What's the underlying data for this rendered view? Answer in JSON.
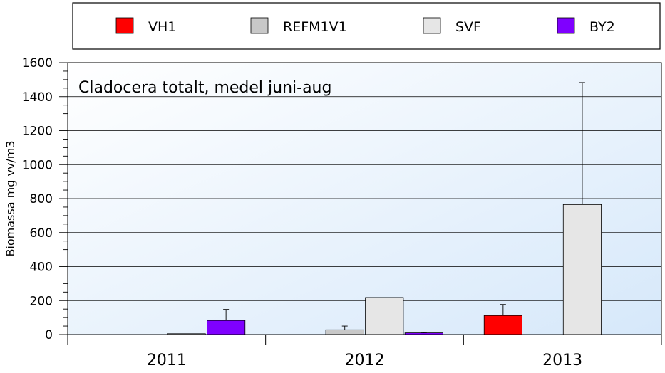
{
  "chart_data": {
    "type": "bar",
    "title": "Cladocera totalt, medel juni-aug",
    "ylabel": "Biomassa mg vv/m3",
    "xlabel": "",
    "ylim": [
      0,
      1600
    ],
    "yticks": [
      0,
      200,
      400,
      600,
      800,
      1000,
      1200,
      1400,
      1600
    ],
    "grid": true,
    "legend_position": "top",
    "categories": [
      "2011",
      "2012",
      "2013"
    ],
    "series": [
      {
        "name": "VH1",
        "color": "#ff0000",
        "values": [
          0,
          0,
          112
        ],
        "errors": [
          null,
          null,
          65
        ]
      },
      {
        "name": "REFM1V1",
        "color": "#c8c8c8",
        "values": [
          0,
          28,
          0
        ],
        "errors": [
          null,
          22,
          null
        ]
      },
      {
        "name": "SVF",
        "color": "#e6e6e6",
        "values": [
          5,
          218,
          765
        ],
        "errors": [
          null,
          null,
          718
        ]
      },
      {
        "name": "BY2",
        "color": "#7f00ff",
        "values": [
          83,
          10,
          0
        ],
        "errors": [
          65,
          3,
          null
        ]
      }
    ]
  }
}
